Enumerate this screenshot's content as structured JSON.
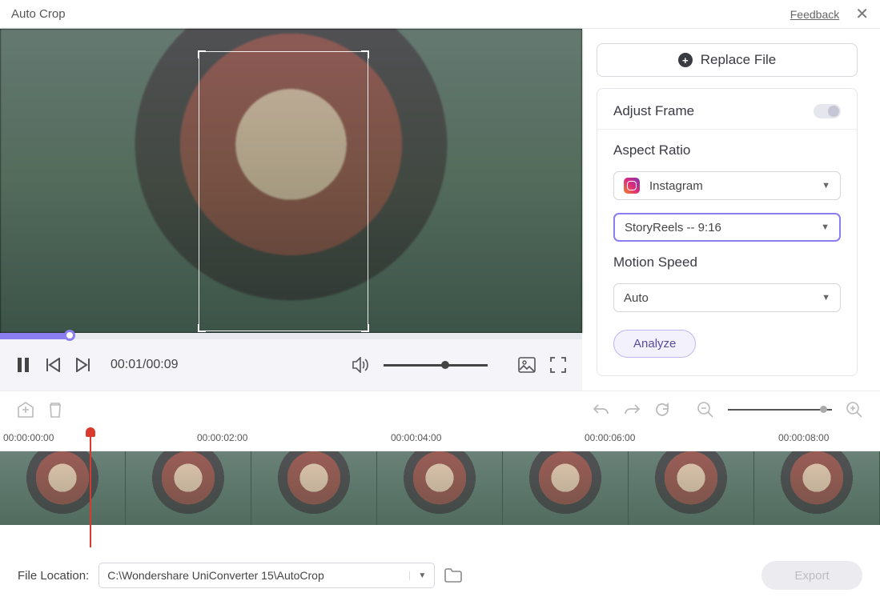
{
  "header": {
    "title": "Auto Crop",
    "feedback": "Feedback"
  },
  "player": {
    "time": "00:01/00:09"
  },
  "right": {
    "replace": "Replace File",
    "adjust_frame": "Adjust Frame",
    "aspect_ratio_label": "Aspect Ratio",
    "platform": "Instagram",
    "ratio": "StoryReels -- 9:16",
    "motion_label": "Motion Speed",
    "motion_value": "Auto",
    "analyze": "Analyze"
  },
  "timeline": {
    "ticks": [
      "00:00:00:00",
      "00:00:02:00",
      "00:00:04:00",
      "00:00:06:00",
      "00:00:08:00"
    ]
  },
  "footer": {
    "label": "File Location:",
    "path": "C:\\Wondershare UniConverter 15\\AutoCrop",
    "export": "Export"
  }
}
